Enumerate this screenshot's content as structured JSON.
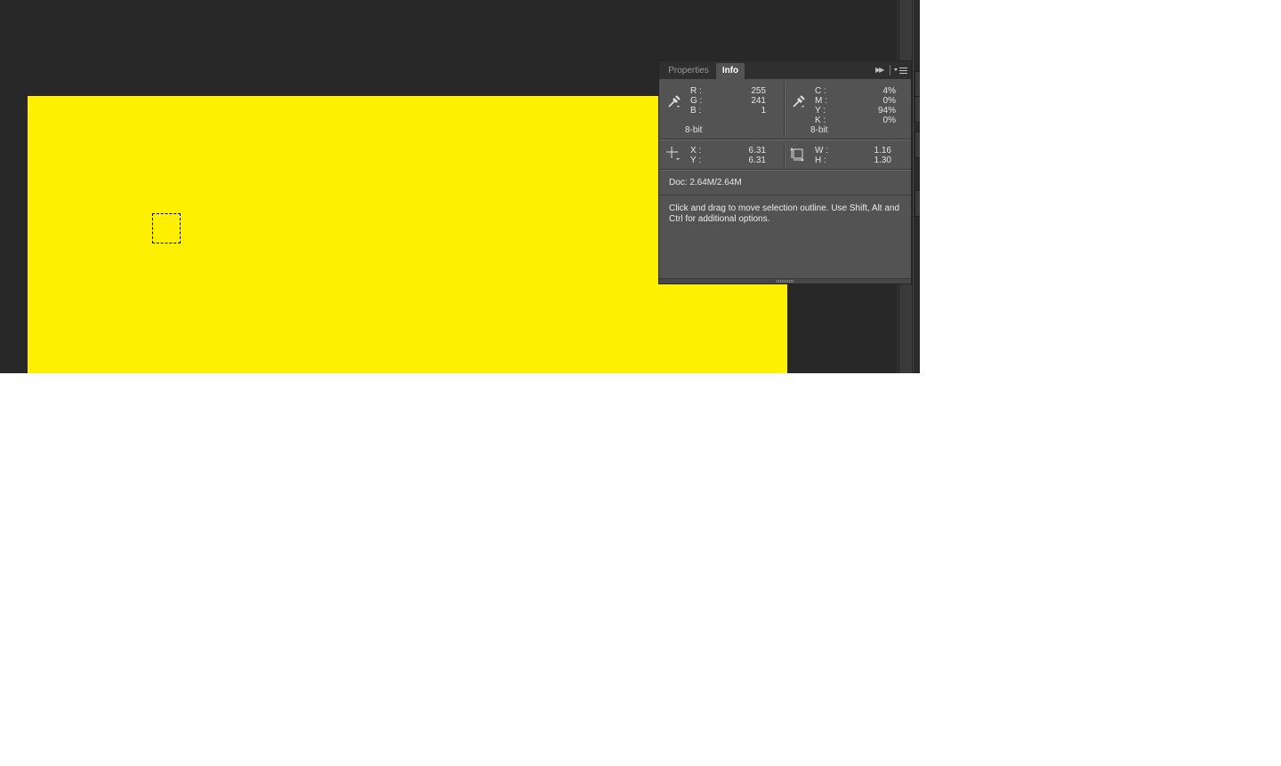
{
  "panel": {
    "tabs": [
      {
        "label": "Properties",
        "active": false
      },
      {
        "label": "Info",
        "active": true
      }
    ],
    "collapse_glyph": "▶▶",
    "rgb": {
      "rows": [
        {
          "label": "R :",
          "value": "255"
        },
        {
          "label": "G :",
          "value": "241"
        },
        {
          "label": "B :",
          "value": "1"
        }
      ],
      "bit_depth": "8-bit",
      "icon": "eyedropper-icon"
    },
    "cmyk": {
      "rows": [
        {
          "label": "C :",
          "value": "4%"
        },
        {
          "label": "M :",
          "value": "0%"
        },
        {
          "label": "Y :",
          "value": "94%"
        },
        {
          "label": "K :",
          "value": "0%"
        }
      ],
      "bit_depth": "8-bit",
      "icon": "eyedropper-icon"
    },
    "position": {
      "rows": [
        {
          "label": "X :",
          "value": "6.31"
        },
        {
          "label": "Y :",
          "value": "6.31"
        }
      ],
      "icon": "crosshair-icon"
    },
    "size": {
      "rows": [
        {
          "label": "W :",
          "value": "1.16"
        },
        {
          "label": "H :",
          "value": "1.30"
        }
      ],
      "icon": "selection-size-icon"
    },
    "doc_info": "Doc: 2.64M/2.64M",
    "hint": "Click and drag to move selection outline.  Use Shift, Alt and Ctrl for additional options."
  },
  "colors": {
    "workspace": "#282828",
    "canvas_fill": "#ffef00",
    "panel_bg": "#535353",
    "panel_header": "#2f2f2f"
  }
}
